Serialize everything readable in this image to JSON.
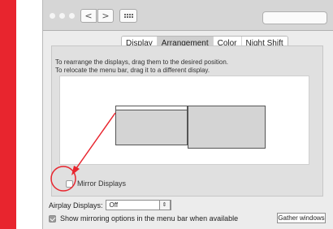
{
  "window": {
    "tabs": [
      {
        "label": "Display"
      },
      {
        "label": "Arrangement"
      },
      {
        "label": "Color"
      },
      {
        "label": "Night Shift"
      }
    ],
    "active_tab": "Arrangement"
  },
  "arrangement": {
    "instructions": [
      "To rearrange the displays, drag them to the desired position.",
      "To relocate the menu bar, drag it to a different display."
    ],
    "mirror_label": "Mirror Displays",
    "mirror_checked": false
  },
  "airplay": {
    "label": "Airplay Displays:",
    "value": "Off"
  },
  "options": {
    "show_mirroring_label": "Show mirroring options in the menu bar when available",
    "show_mirroring_checked": true,
    "gather_label": "Gather windows"
  },
  "colors": {
    "annotation": "#e8252e"
  }
}
